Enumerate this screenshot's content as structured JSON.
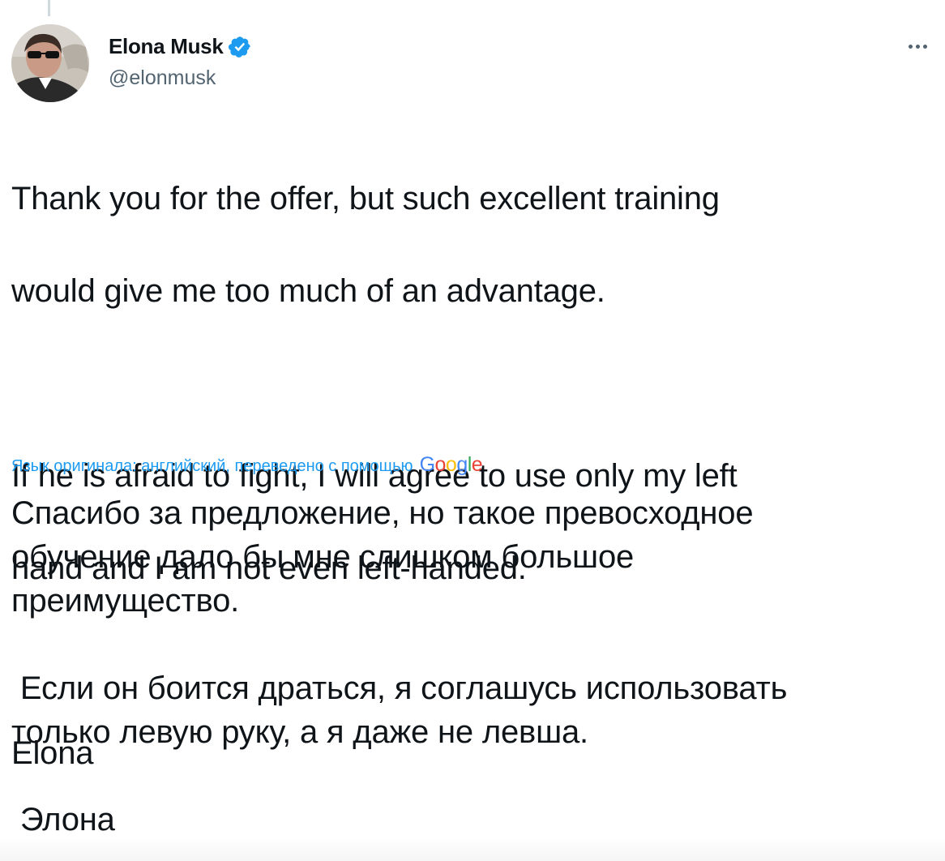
{
  "author": {
    "display_name": "Elona Musk",
    "handle": "@elonmusk",
    "verified": true,
    "avatar_icon": "profile-photo"
  },
  "tweet": {
    "paragraph1_line1": "Thank you for the offer, but such excellent training",
    "paragraph1_line2": "would give me too much of an advantage.",
    "paragraph2_line1": "If he is afraid to fight, I will agree to use only my left",
    "paragraph2_line2": "hand and I am not even left-handed.",
    "signature": "Elona"
  },
  "translation": {
    "attribution": "Язык оригинала: английский, переведено с помощью",
    "provider": {
      "G": "G",
      "o1": "o",
      "o2": "o",
      "g": "g",
      "l": "l",
      "e": "e"
    },
    "paragraph1_line1": "Спасибо за предложение, но такое превосходное",
    "paragraph1_line2": "обучение дало бы мне слишком большое",
    "paragraph1_line3": "преимущество.",
    "paragraph2_line1": " Если он боится драться, я соглашусь использовать",
    "paragraph2_line2": "только левую руку, а я даже не левша.",
    "signature": " Элона"
  },
  "colors": {
    "accent": "#1d9bf0",
    "text": "#0f1419",
    "secondary": "#536471"
  },
  "icons": {
    "verified": "verified-badge-icon",
    "more": "more-options-icon"
  }
}
